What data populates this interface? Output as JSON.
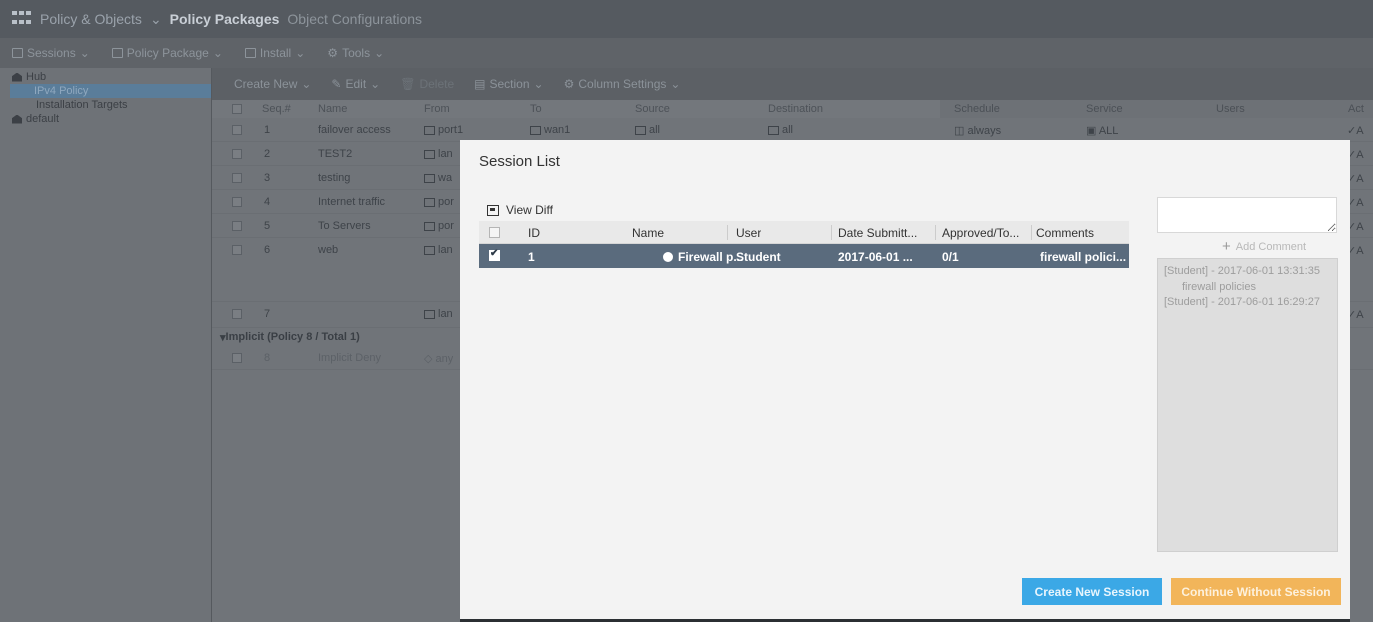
{
  "topnav": {
    "crumbs": [
      "Policy & Objects",
      "Policy Packages",
      "Object Configurations"
    ]
  },
  "toolbar": {
    "sessions": "Sessions",
    "policy_package": "Policy Package",
    "install": "Install",
    "tools": "Tools"
  },
  "tree": {
    "hub": "Hub",
    "ipv4": "IPv4 Policy",
    "targets": "Installation Targets",
    "default": "default"
  },
  "policy_toolbar": {
    "create_new": "Create New",
    "edit": "Edit",
    "delete": "Delete",
    "section": "Section",
    "column_settings": "Column Settings"
  },
  "policy_columns": {
    "seq": "Seq.#",
    "name": "Name",
    "from": "From",
    "to": "To",
    "source": "Source",
    "destination": "Destination",
    "schedule": "Schedule",
    "service": "Service",
    "users": "Users",
    "action": "Act"
  },
  "policy_rows": [
    {
      "seq": "1",
      "name": "failover access",
      "from": "port1",
      "to": "wan1",
      "source": "all",
      "destination": "all"
    },
    {
      "seq": "2",
      "name": "TEST2",
      "from": "lan"
    },
    {
      "seq": "3",
      "name": "testing",
      "from": "wa"
    },
    {
      "seq": "4",
      "name": "Internet traffic",
      "from": "por"
    },
    {
      "seq": "5",
      "name": "To Servers",
      "from": "por"
    },
    {
      "seq": "6",
      "name": "web",
      "from": "lan"
    },
    {
      "seq": "7",
      "name": "",
      "from": "lan"
    }
  ],
  "implicit": {
    "label": "Implicit (Policy 8 / Total 1)",
    "seq": "8",
    "name": "Implicit Deny",
    "from": "any"
  },
  "row1_right": {
    "schedule": "always",
    "service": "ALL"
  },
  "modal": {
    "title": "Session List",
    "view_diff": "View Diff",
    "columns": {
      "id": "ID",
      "name": "Name",
      "user": "User",
      "date": "Date Submitt...",
      "approved": "Approved/To...",
      "comments": "Comments"
    },
    "session": {
      "id": "1",
      "name": "Firewall p...",
      "user": "Student",
      "date": "2017-06-01 ...",
      "approved": "0/1",
      "comments": "firewall polici..."
    },
    "add_comment": "Add Comment",
    "comments": [
      {
        "header": "[Student] - 2017-06-01 13:31:35",
        "body": "firewall policies"
      },
      {
        "header": "[Student] - 2017-06-01 16:29:27",
        "body": ""
      }
    ],
    "create_new_session": "Create New Session",
    "continue_without_session": "Continue Without Session"
  }
}
